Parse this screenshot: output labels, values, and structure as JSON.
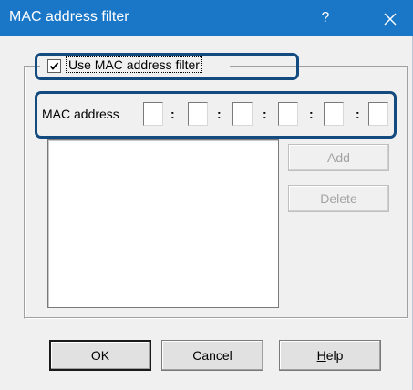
{
  "window": {
    "title": "MAC address filter",
    "help_label": "?",
    "close_icon": "close-icon"
  },
  "filter": {
    "checkbox_label": "Use MAC address filter",
    "checked": true
  },
  "mac": {
    "label": "MAC address",
    "separator": ":",
    "octets": [
      "",
      "",
      "",
      "",
      "",
      ""
    ]
  },
  "list": {
    "items": []
  },
  "side_buttons": {
    "add_label": "Add",
    "delete_label": "Delete"
  },
  "footer": {
    "ok_label": "OK",
    "cancel_label": "Cancel",
    "help_label": "Help"
  },
  "colors": {
    "titlebar": "#1a77c8",
    "highlight": "#134a7f",
    "dialog_bg": "#f0f0f0"
  }
}
